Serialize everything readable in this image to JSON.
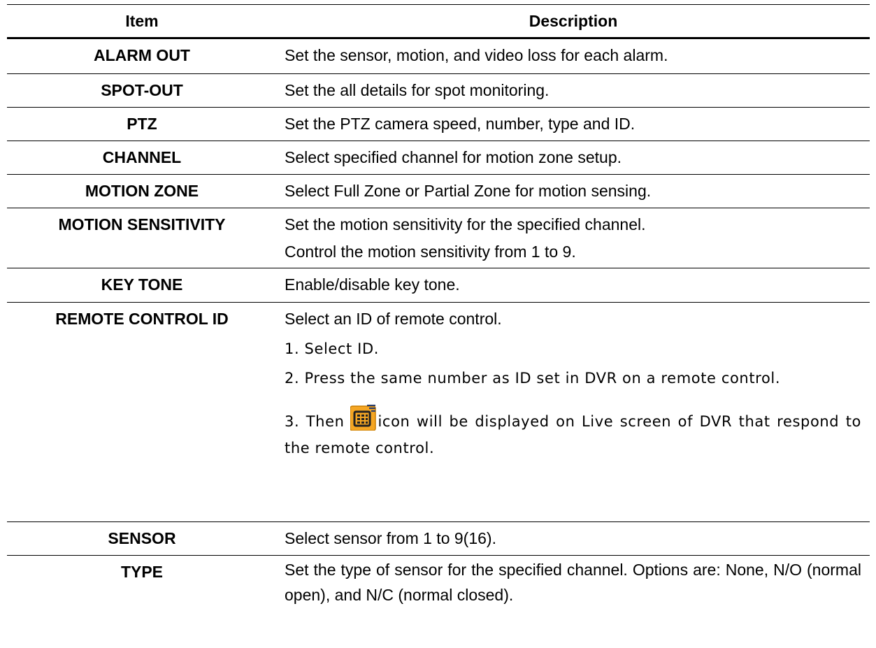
{
  "header": {
    "item": "Item",
    "description": "Description"
  },
  "rows": [
    {
      "item": "ALARM OUT",
      "lines": [
        "Set the sensor, motion, and video loss for each alarm."
      ]
    },
    {
      "item": "SPOT-OUT",
      "lines": [
        "Set the all details for spot monitoring."
      ]
    },
    {
      "item": "PTZ",
      "lines": [
        "Set the PTZ camera speed, number, type and ID."
      ]
    },
    {
      "item": "CHANNEL",
      "lines": [
        "Select specified channel for motion zone setup."
      ]
    },
    {
      "item": "MOTION ZONE",
      "lines": [
        "Select Full Zone or Partial Zone for motion sensing."
      ]
    },
    {
      "item": "MOTION SENSITIVITY",
      "lines": [
        "Set the motion sensitivity for the specified channel.",
        "Control the motion sensitivity from 1 to 9."
      ]
    },
    {
      "item": "KEY TONE",
      "lines": [
        "Enable/disable key tone."
      ]
    },
    {
      "item": "REMOTE CONTROL ID",
      "lines": [
        "Select an ID of remote control.",
        "1. Select ID.",
        "2. Press the same number as ID set in DVR on a remote control.",
        "3. Then",
        "icon will be displayed on Live screen of DVR that respond to the remote control."
      ],
      "icon": "remote-control-icon"
    },
    {
      "item": "SENSOR",
      "lines": [
        "Select sensor from 1 to 9(16)."
      ]
    },
    {
      "item": "TYPE",
      "lines": [
        "Set the type of sensor for the specified channel. Options are: None, N/O (normal open), and N/C (normal closed)."
      ]
    }
  ],
  "colors": {
    "icon_background": "#f5a623",
    "icon_frame": "#222222"
  }
}
